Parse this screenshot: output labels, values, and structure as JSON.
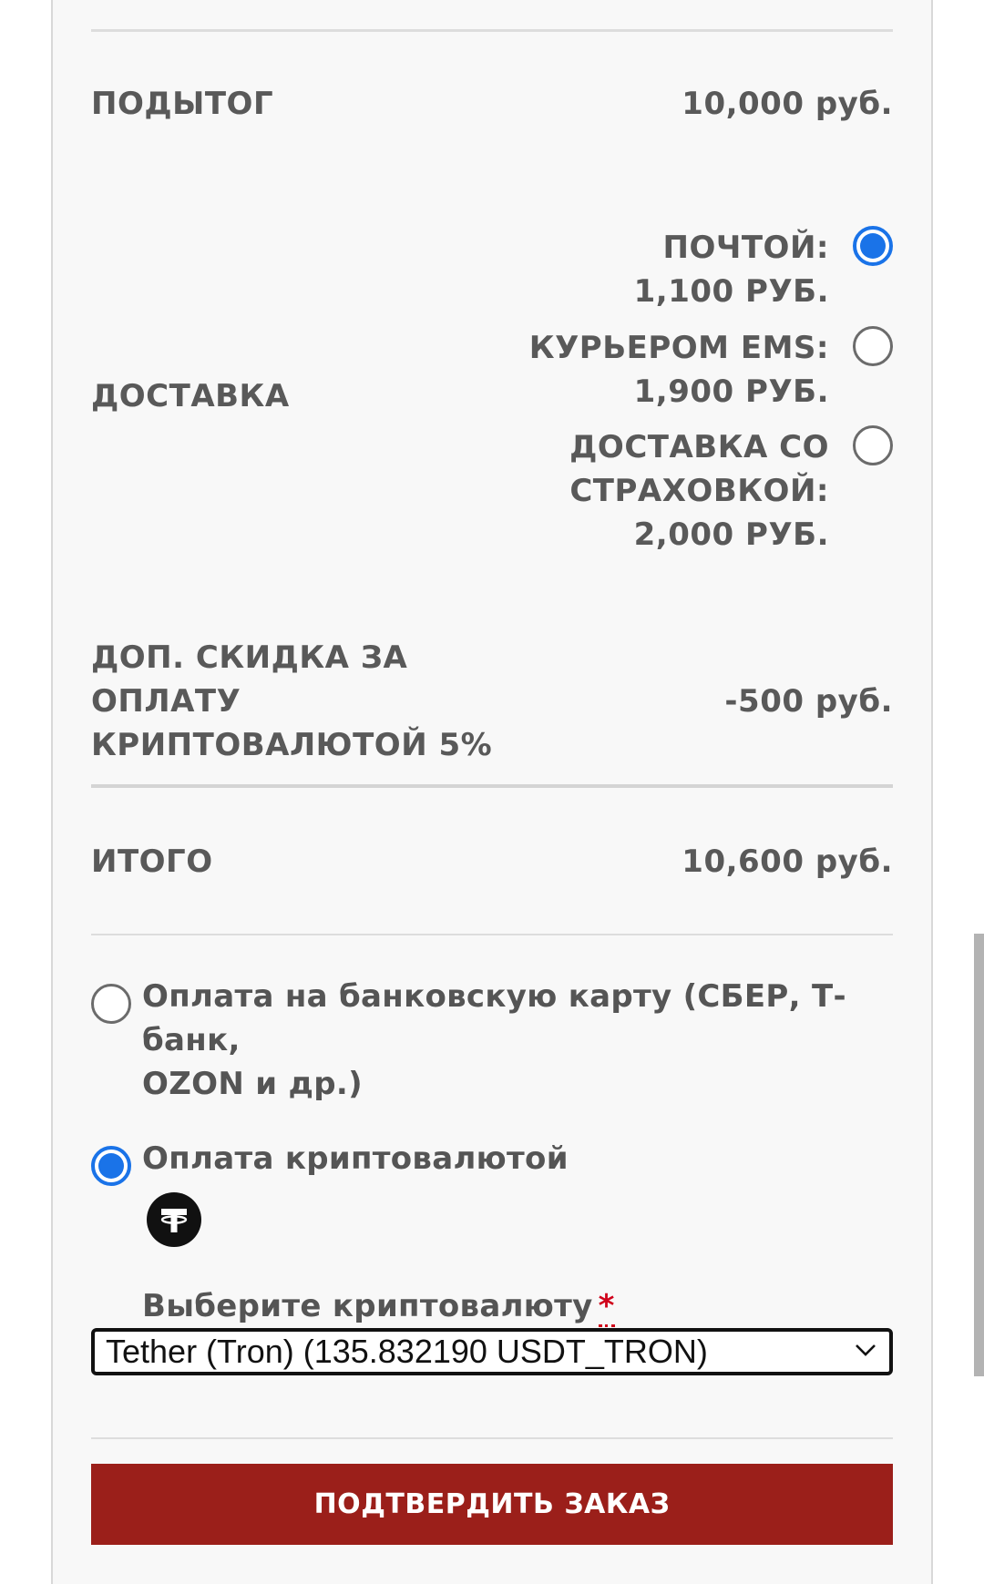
{
  "summary": {
    "subtotal_label": "Подытог",
    "subtotal_value": "10,000 руб.",
    "shipping_label": "Доставка",
    "shipping_options": [
      {
        "name": "Почтой:",
        "price": "1,100 руб.",
        "selected": true
      },
      {
        "name": "Курьером EMS:",
        "price": "1,900 руб.",
        "selected": false
      },
      {
        "name_line1": "Доставка со",
        "name_line2": "страховкой:",
        "price": "2,000 руб.",
        "selected": false
      }
    ],
    "discount_label_line1": "Доп. скидка за",
    "discount_label_line2": "оплату",
    "discount_label_line3": "криптовалютой 5%",
    "discount_value": "-500 руб.",
    "total_label": "Итого",
    "total_value": "10,600 руб."
  },
  "payment": {
    "options": [
      {
        "label_line1": "Оплата на банковскую карту (СБЕР, Т-банк,",
        "label_line2": "OZON и др.)",
        "selected": false
      },
      {
        "label": "Оплата криптовалютой",
        "icon": "tether-icon",
        "selected": true
      }
    ],
    "select_label": "Выберите криптовалюту",
    "required_mark": "*",
    "selected_currency": "Tether (Tron) (135.832190 USDT_TRON)"
  },
  "actions": {
    "confirm_label": "Подтвердить заказ"
  },
  "colors": {
    "accent_radio": "#1a73e8",
    "confirm_button": "#9b1f1a",
    "required": "#d0021b",
    "text": "#595959"
  }
}
